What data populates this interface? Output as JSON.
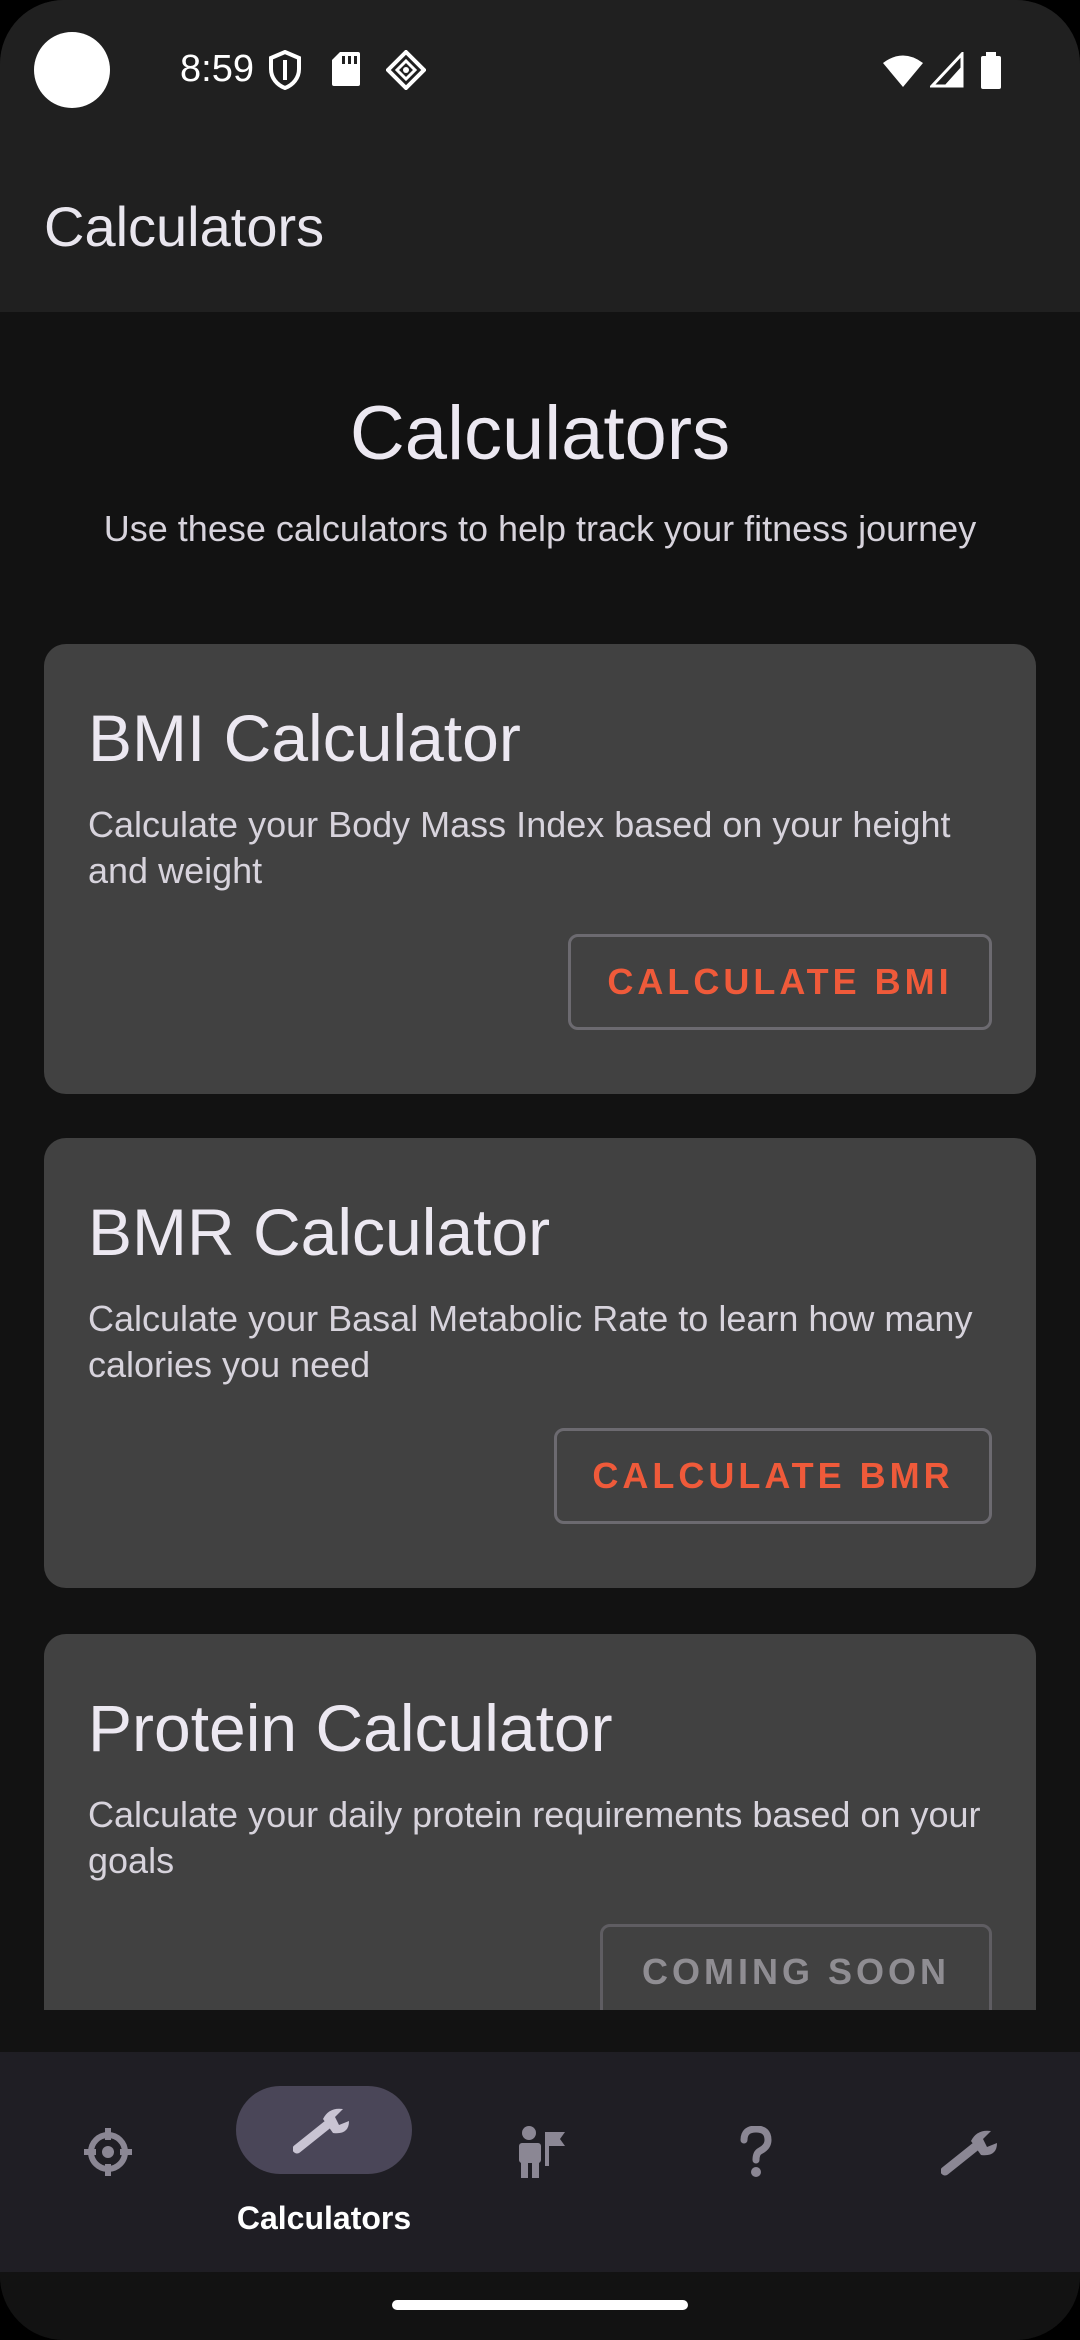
{
  "status_bar": {
    "time": "8:59",
    "icons_left": [
      "shield-icon",
      "sd-card-icon",
      "network-badge-icon"
    ],
    "icons_right": [
      "wifi-icon",
      "cell-signal-icon",
      "battery-icon"
    ]
  },
  "app_bar": {
    "title": "Calculators"
  },
  "main": {
    "title": "Calculators",
    "subtitle": "Use these calculators to help track your fitness journey",
    "cards": [
      {
        "title": "BMI Calculator",
        "description": "Calculate your Body Mass Index based on your height and weight",
        "button": "CALCULATE BMI"
      },
      {
        "title": "BMR Calculator",
        "description": "Calculate your Basal Metabolic Rate to learn how many calories you need",
        "button": "CALCULATE BMR"
      },
      {
        "title": "Protein Calculator",
        "description": "Calculate your daily protein requirements based on your goals",
        "button": "COMING SOON"
      }
    ]
  },
  "bottom_nav": {
    "items": [
      {
        "icon": "target-icon",
        "label": ""
      },
      {
        "icon": "wrench-icon",
        "label": "Calculators",
        "active": true
      },
      {
        "icon": "person-flag-icon",
        "label": ""
      },
      {
        "icon": "question-icon",
        "label": ""
      },
      {
        "icon": "wrench-icon",
        "label": ""
      }
    ]
  },
  "colors": {
    "accent": "#ef5a3a",
    "card_bg": "#414141",
    "page_bg": "#121212",
    "bar_bg": "#202020",
    "nav_active_pill": "#4a4658"
  }
}
